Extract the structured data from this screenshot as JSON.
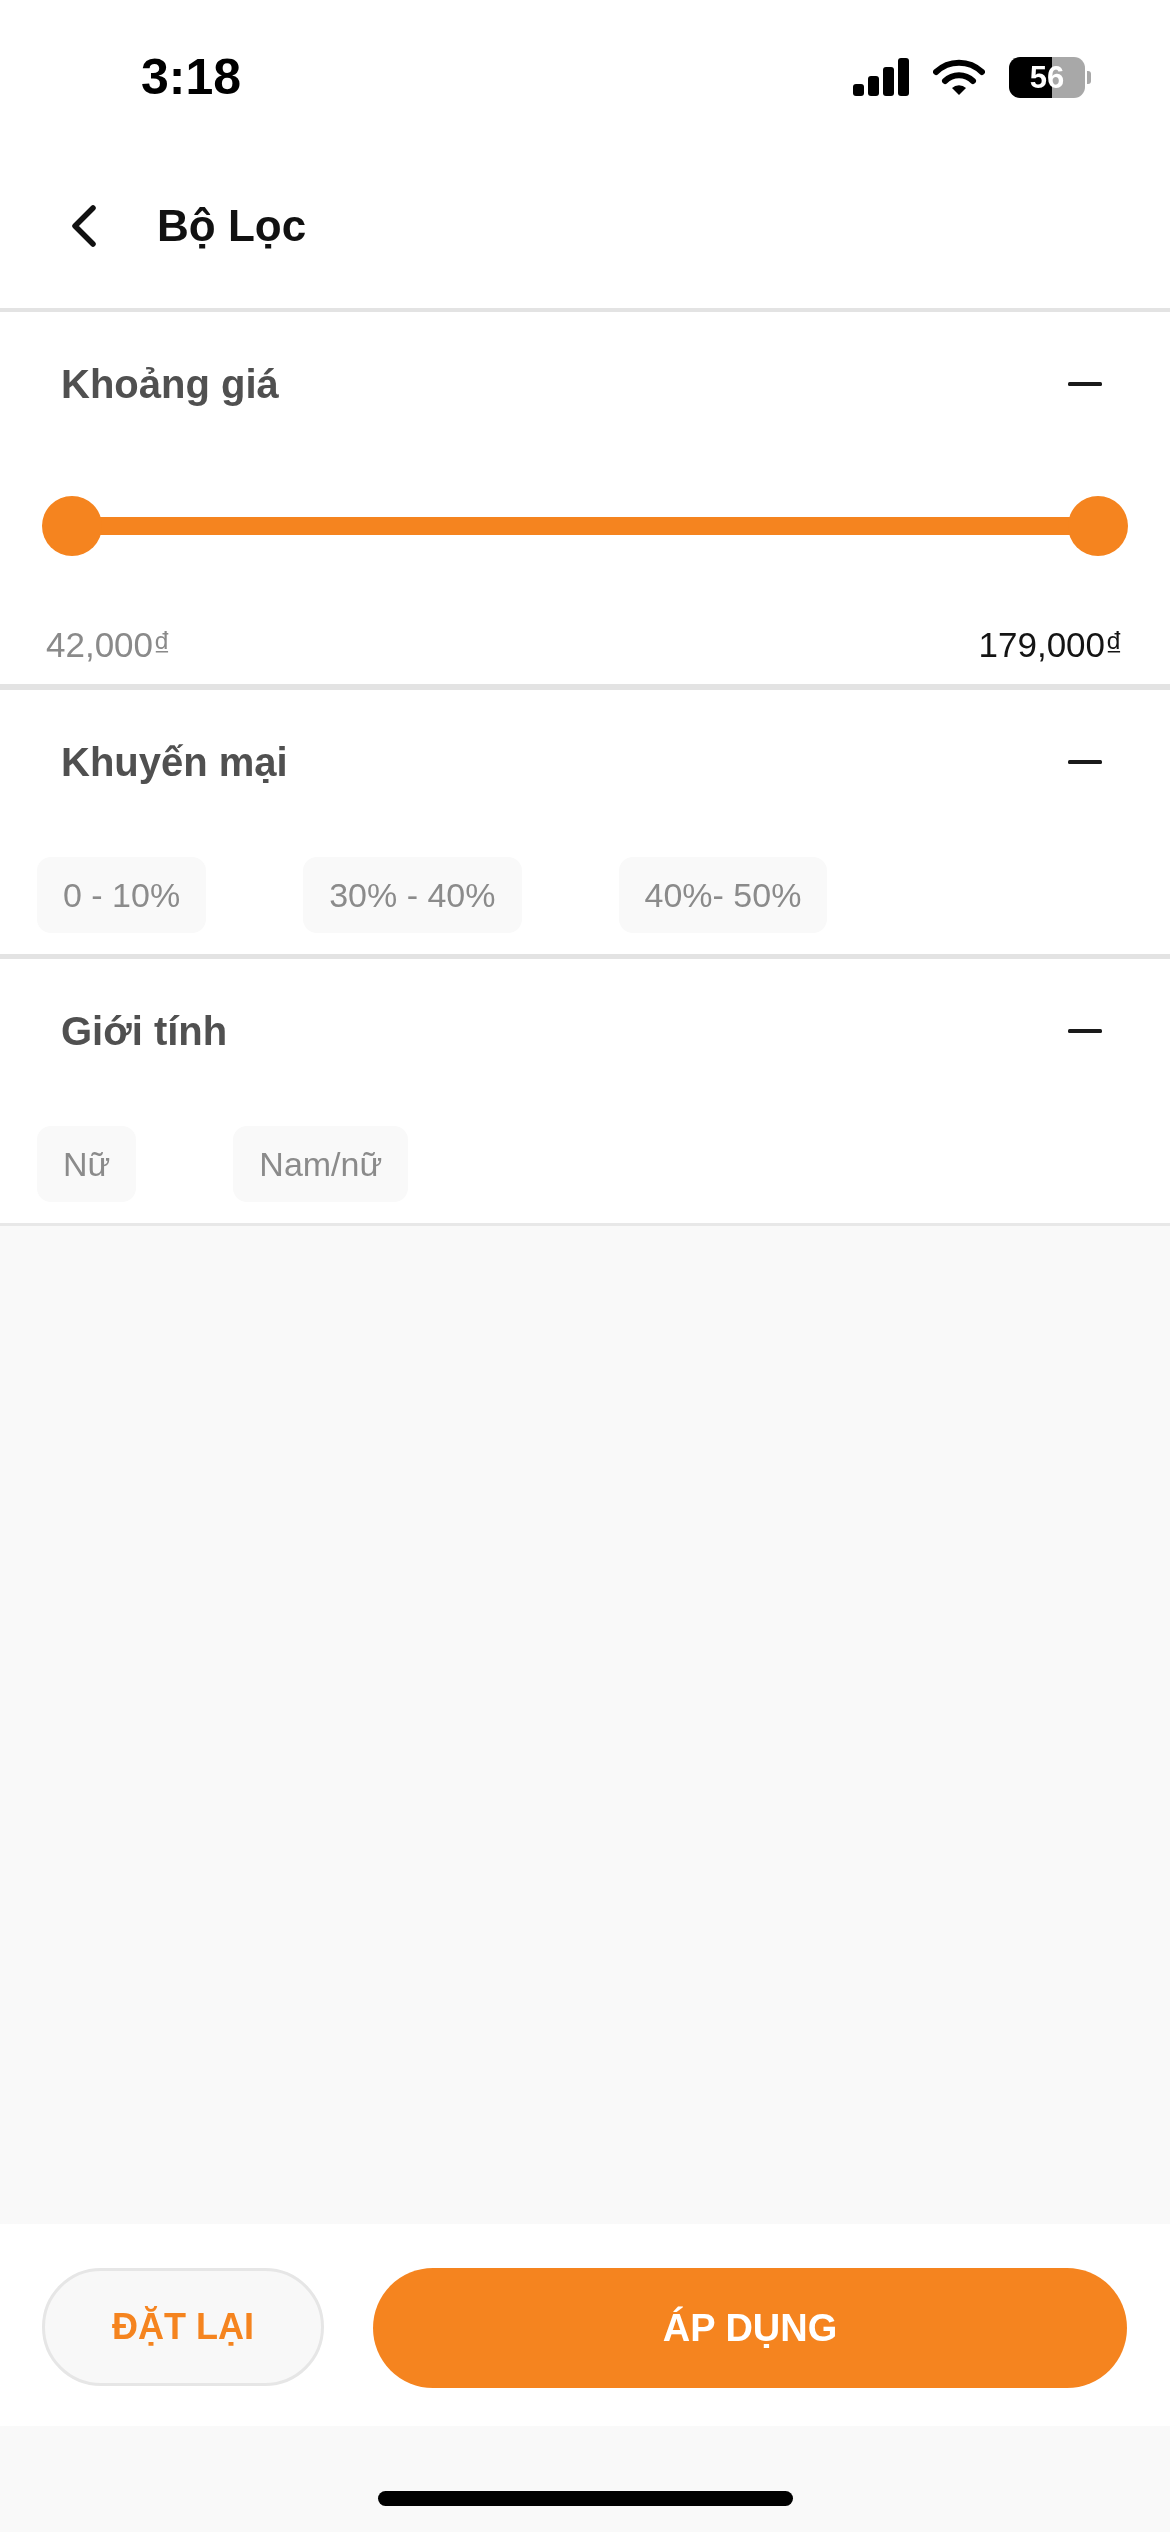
{
  "status_bar": {
    "time": "3:18",
    "battery": "56"
  },
  "header": {
    "title": "Bộ Lọc"
  },
  "sections": [
    {
      "kind": "range",
      "title": "Khoảng giá",
      "expanded": true,
      "thumbs": [
        {
          "level": 0
        },
        {
          "level": 1
        }
      ],
      "min_label": "42,000₫",
      "max_label": "179,000₫"
    },
    {
      "kind": "chips",
      "title": "Khuyến mại",
      "expanded": true,
      "options": [
        {
          "label": "0 - 10%",
          "selected": false
        },
        {
          "label": "30% - 40%",
          "selected": false
        },
        {
          "label": "40%- 50%",
          "selected": false
        }
      ]
    },
    {
      "kind": "chips",
      "title": "Giới tính",
      "expanded": true,
      "options": [
        {
          "label": "Nữ",
          "selected": false
        },
        {
          "label": "Nam/nữ",
          "selected": false
        }
      ]
    }
  ],
  "footer": {
    "reset_button": "ĐẶT LẠI",
    "apply_button": "ÁP DỤNG"
  }
}
